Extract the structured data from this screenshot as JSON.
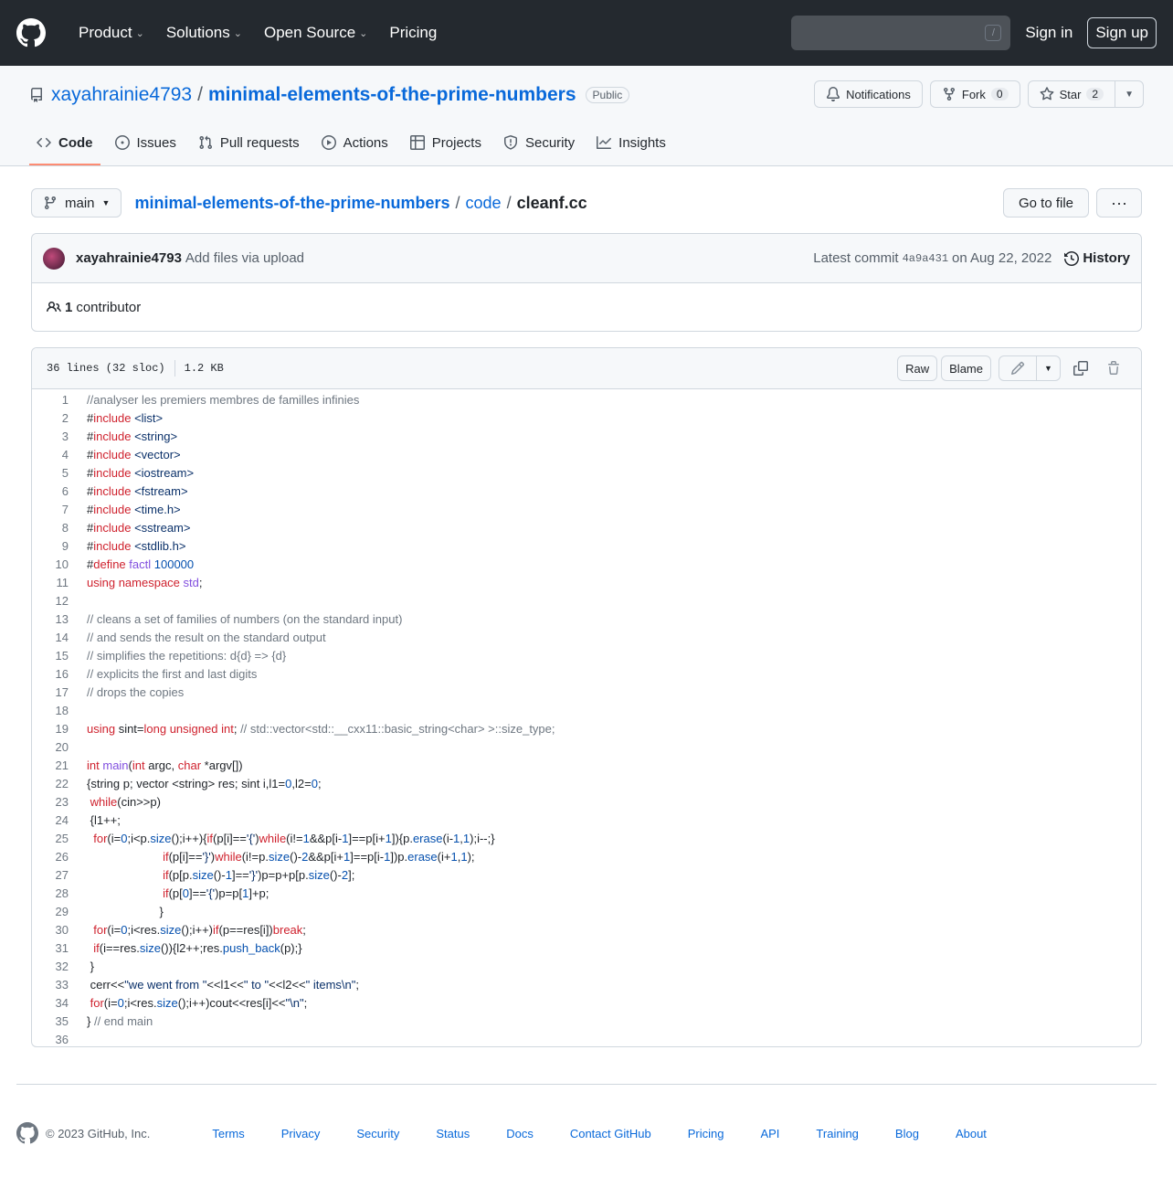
{
  "header": {
    "nav": [
      {
        "label": "Product",
        "chevron": true
      },
      {
        "label": "Solutions",
        "chevron": true
      },
      {
        "label": "Open Source",
        "chevron": true
      },
      {
        "label": "Pricing",
        "chevron": false
      }
    ],
    "search_shortcut": "/",
    "sign_in": "Sign in",
    "sign_up": "Sign up"
  },
  "repo": {
    "owner": "xayahrainie4793",
    "separator": "/",
    "name": "minimal-elements-of-the-prime-numbers",
    "visibility": "Public",
    "notifications_label": "Notifications",
    "fork_label": "Fork",
    "fork_count": "0",
    "star_label": "Star",
    "star_count": "2"
  },
  "tabs": [
    {
      "label": "Code",
      "icon": "code-icon",
      "active": true
    },
    {
      "label": "Issues",
      "icon": "issue-icon",
      "active": false
    },
    {
      "label": "Pull requests",
      "icon": "pull-request-icon",
      "active": false
    },
    {
      "label": "Actions",
      "icon": "play-icon",
      "active": false
    },
    {
      "label": "Projects",
      "icon": "table-icon",
      "active": false
    },
    {
      "label": "Security",
      "icon": "shield-icon",
      "active": false
    },
    {
      "label": "Insights",
      "icon": "graph-icon",
      "active": false
    }
  ],
  "breadcrumb": {
    "branch": "main",
    "repo": "minimal-elements-of-the-prime-numbers",
    "dir": "code",
    "file": "cleanf.cc",
    "go_to_file": "Go to file",
    "more": "···"
  },
  "commit": {
    "author": "xayahrainie4793",
    "message": "Add files via upload",
    "latest_prefix": "Latest commit",
    "sha": "4a9a431",
    "date": "on Aug 22, 2022",
    "history": "History",
    "contributors_count": "1",
    "contributors_label": "contributor"
  },
  "file": {
    "lines_info": "36 lines (32 sloc)",
    "size": "1.2 KB",
    "raw": "Raw",
    "blame": "Blame"
  },
  "code_lines": [
    [
      {
        "t": "//analyser les premiers membres de familles infinies",
        "c": "cm"
      }
    ],
    [
      {
        "t": "#",
        "c": "tx"
      },
      {
        "t": "include",
        "c": "kw"
      },
      {
        "t": " ",
        "c": "tx"
      },
      {
        "t": "<list>",
        "c": "st"
      }
    ],
    [
      {
        "t": "#",
        "c": "tx"
      },
      {
        "t": "include",
        "c": "kw"
      },
      {
        "t": " ",
        "c": "tx"
      },
      {
        "t": "<string>",
        "c": "st"
      }
    ],
    [
      {
        "t": "#",
        "c": "tx"
      },
      {
        "t": "include",
        "c": "kw"
      },
      {
        "t": " ",
        "c": "tx"
      },
      {
        "t": "<vector>",
        "c": "st"
      }
    ],
    [
      {
        "t": "#",
        "c": "tx"
      },
      {
        "t": "include",
        "c": "kw"
      },
      {
        "t": " ",
        "c": "tx"
      },
      {
        "t": "<iostream>",
        "c": "st"
      }
    ],
    [
      {
        "t": "#",
        "c": "tx"
      },
      {
        "t": "include",
        "c": "kw"
      },
      {
        "t": " ",
        "c": "tx"
      },
      {
        "t": "<fstream>",
        "c": "st"
      }
    ],
    [
      {
        "t": "#",
        "c": "tx"
      },
      {
        "t": "include",
        "c": "kw"
      },
      {
        "t": " ",
        "c": "tx"
      },
      {
        "t": "<time.h>",
        "c": "st"
      }
    ],
    [
      {
        "t": "#",
        "c": "tx"
      },
      {
        "t": "include",
        "c": "kw"
      },
      {
        "t": " ",
        "c": "tx"
      },
      {
        "t": "<sstream>",
        "c": "st"
      }
    ],
    [
      {
        "t": "#",
        "c": "tx"
      },
      {
        "t": "include",
        "c": "kw"
      },
      {
        "t": " ",
        "c": "tx"
      },
      {
        "t": "<stdlib.h>",
        "c": "st"
      }
    ],
    [
      {
        "t": "#",
        "c": "tx"
      },
      {
        "t": "define",
        "c": "kw"
      },
      {
        "t": " ",
        "c": "tx"
      },
      {
        "t": "factl",
        "c": "fn"
      },
      {
        "t": " ",
        "c": "tx"
      },
      {
        "t": "100000",
        "c": "nm"
      }
    ],
    [
      {
        "t": "using",
        "c": "kw"
      },
      {
        "t": " ",
        "c": "tx"
      },
      {
        "t": "namespace",
        "c": "kw"
      },
      {
        "t": " ",
        "c": "tx"
      },
      {
        "t": "std",
        "c": "fn"
      },
      {
        "t": ";",
        "c": "tx"
      }
    ],
    [],
    [
      {
        "t": "// cleans a set of families of numbers (on the standard input)",
        "c": "cm"
      }
    ],
    [
      {
        "t": "// and sends the result on the standard output",
        "c": "cm"
      }
    ],
    [
      {
        "t": "// simplifies the repetitions: d{d} => {d}",
        "c": "cm"
      }
    ],
    [
      {
        "t": "// explicits the first and last digits",
        "c": "cm"
      }
    ],
    [
      {
        "t": "// drops the copies",
        "c": "cm"
      }
    ],
    [],
    [
      {
        "t": "using",
        "c": "kw"
      },
      {
        "t": " sint=",
        "c": "tx"
      },
      {
        "t": "long unsigned int",
        "c": "kw"
      },
      {
        "t": "; ",
        "c": "tx"
      },
      {
        "t": "// std::vector<std::__cxx11::basic_string<char> >::size_type;",
        "c": "cm"
      }
    ],
    [],
    [
      {
        "t": "int",
        "c": "kw"
      },
      {
        "t": " ",
        "c": "tx"
      },
      {
        "t": "main",
        "c": "fn"
      },
      {
        "t": "(",
        "c": "tx"
      },
      {
        "t": "int",
        "c": "kw"
      },
      {
        "t": " argc, ",
        "c": "tx"
      },
      {
        "t": "char",
        "c": "kw"
      },
      {
        "t": " *argv[])",
        "c": "tx"
      }
    ],
    [
      {
        "t": "{string p; vector <string> res; sint i,l1=",
        "c": "tx"
      },
      {
        "t": "0",
        "c": "nm"
      },
      {
        "t": ",l2=",
        "c": "tx"
      },
      {
        "t": "0",
        "c": "nm"
      },
      {
        "t": ";",
        "c": "tx"
      }
    ],
    [
      {
        "t": " ",
        "c": "tx"
      },
      {
        "t": "while",
        "c": "kw"
      },
      {
        "t": "(cin>>p)",
        "c": "tx"
      }
    ],
    [
      {
        "t": " {l1++;",
        "c": "tx"
      }
    ],
    [
      {
        "t": "  ",
        "c": "tx"
      },
      {
        "t": "for",
        "c": "kw"
      },
      {
        "t": "(i=",
        "c": "tx"
      },
      {
        "t": "0",
        "c": "nm"
      },
      {
        "t": ";i<p.",
        "c": "tx"
      },
      {
        "t": "size",
        "c": "bl"
      },
      {
        "t": "();i++){",
        "c": "tx"
      },
      {
        "t": "if",
        "c": "kw"
      },
      {
        "t": "(p[i]==",
        "c": "tx"
      },
      {
        "t": "'{'",
        "c": "st"
      },
      {
        "t": ")",
        "c": "tx"
      },
      {
        "t": "while",
        "c": "kw"
      },
      {
        "t": "(i!=",
        "c": "tx"
      },
      {
        "t": "1",
        "c": "nm"
      },
      {
        "t": "&&p[i-",
        "c": "tx"
      },
      {
        "t": "1",
        "c": "nm"
      },
      {
        "t": "]==p[i+",
        "c": "tx"
      },
      {
        "t": "1",
        "c": "nm"
      },
      {
        "t": "]){p.",
        "c": "tx"
      },
      {
        "t": "erase",
        "c": "bl"
      },
      {
        "t": "(i-",
        "c": "tx"
      },
      {
        "t": "1",
        "c": "nm"
      },
      {
        "t": ",",
        "c": "tx"
      },
      {
        "t": "1",
        "c": "nm"
      },
      {
        "t": ");i--;}",
        "c": "tx"
      }
    ],
    [
      {
        "t": "                       ",
        "c": "tx"
      },
      {
        "t": "if",
        "c": "kw"
      },
      {
        "t": "(p[i]==",
        "c": "tx"
      },
      {
        "t": "'}'",
        "c": "st"
      },
      {
        "t": ")",
        "c": "tx"
      },
      {
        "t": "while",
        "c": "kw"
      },
      {
        "t": "(i!=p.",
        "c": "tx"
      },
      {
        "t": "size",
        "c": "bl"
      },
      {
        "t": "()-",
        "c": "tx"
      },
      {
        "t": "2",
        "c": "nm"
      },
      {
        "t": "&&p[i+",
        "c": "tx"
      },
      {
        "t": "1",
        "c": "nm"
      },
      {
        "t": "]==p[i-",
        "c": "tx"
      },
      {
        "t": "1",
        "c": "nm"
      },
      {
        "t": "])p.",
        "c": "tx"
      },
      {
        "t": "erase",
        "c": "bl"
      },
      {
        "t": "(i+",
        "c": "tx"
      },
      {
        "t": "1",
        "c": "nm"
      },
      {
        "t": ",",
        "c": "tx"
      },
      {
        "t": "1",
        "c": "nm"
      },
      {
        "t": ");",
        "c": "tx"
      }
    ],
    [
      {
        "t": "                       ",
        "c": "tx"
      },
      {
        "t": "if",
        "c": "kw"
      },
      {
        "t": "(p[p.",
        "c": "tx"
      },
      {
        "t": "size",
        "c": "bl"
      },
      {
        "t": "()-",
        "c": "tx"
      },
      {
        "t": "1",
        "c": "nm"
      },
      {
        "t": "]==",
        "c": "tx"
      },
      {
        "t": "'}'",
        "c": "st"
      },
      {
        "t": ")p=p+p[p.",
        "c": "tx"
      },
      {
        "t": "size",
        "c": "bl"
      },
      {
        "t": "()-",
        "c": "tx"
      },
      {
        "t": "2",
        "c": "nm"
      },
      {
        "t": "];",
        "c": "tx"
      }
    ],
    [
      {
        "t": "                       ",
        "c": "tx"
      },
      {
        "t": "if",
        "c": "kw"
      },
      {
        "t": "(p[",
        "c": "tx"
      },
      {
        "t": "0",
        "c": "nm"
      },
      {
        "t": "]==",
        "c": "tx"
      },
      {
        "t": "'{'",
        "c": "st"
      },
      {
        "t": ")p=p[",
        "c": "tx"
      },
      {
        "t": "1",
        "c": "nm"
      },
      {
        "t": "]+p;",
        "c": "tx"
      }
    ],
    [
      {
        "t": "                      }",
        "c": "tx"
      }
    ],
    [
      {
        "t": "  ",
        "c": "tx"
      },
      {
        "t": "for",
        "c": "kw"
      },
      {
        "t": "(i=",
        "c": "tx"
      },
      {
        "t": "0",
        "c": "nm"
      },
      {
        "t": ";i<res.",
        "c": "tx"
      },
      {
        "t": "size",
        "c": "bl"
      },
      {
        "t": "();i++)",
        "c": "tx"
      },
      {
        "t": "if",
        "c": "kw"
      },
      {
        "t": "(p==res[i])",
        "c": "tx"
      },
      {
        "t": "break",
        "c": "kw"
      },
      {
        "t": ";",
        "c": "tx"
      }
    ],
    [
      {
        "t": "  ",
        "c": "tx"
      },
      {
        "t": "if",
        "c": "kw"
      },
      {
        "t": "(i==res.",
        "c": "tx"
      },
      {
        "t": "size",
        "c": "bl"
      },
      {
        "t": "()){l2++;res.",
        "c": "tx"
      },
      {
        "t": "push_back",
        "c": "bl"
      },
      {
        "t": "(p);}",
        "c": "tx"
      }
    ],
    [
      {
        "t": " }",
        "c": "tx"
      }
    ],
    [
      {
        "t": " cerr<<",
        "c": "tx"
      },
      {
        "t": "\"we went from \"",
        "c": "st"
      },
      {
        "t": "<<l1<<",
        "c": "tx"
      },
      {
        "t": "\" to \"",
        "c": "st"
      },
      {
        "t": "<<l2<<",
        "c": "tx"
      },
      {
        "t": "\" items\\n\"",
        "c": "st"
      },
      {
        "t": ";",
        "c": "tx"
      }
    ],
    [
      {
        "t": " ",
        "c": "tx"
      },
      {
        "t": "for",
        "c": "kw"
      },
      {
        "t": "(i=",
        "c": "tx"
      },
      {
        "t": "0",
        "c": "nm"
      },
      {
        "t": ";i<res.",
        "c": "tx"
      },
      {
        "t": "size",
        "c": "bl"
      },
      {
        "t": "();i++)cout<<res[i]<<",
        "c": "tx"
      },
      {
        "t": "\"\\n\"",
        "c": "st"
      },
      {
        "t": ";",
        "c": "tx"
      }
    ],
    [
      {
        "t": "} ",
        "c": "tx"
      },
      {
        "t": "// end main",
        "c": "cm"
      }
    ],
    []
  ],
  "syntax_colors": {
    "cm": "#6e7781",
    "kw": "#cf222e",
    "st": "#0a3069",
    "fn": "#8250df",
    "nm": "#0550ae",
    "bl": "#0550ae",
    "tx": "#1f2328"
  },
  "footer": {
    "copyright": "© 2023 GitHub, Inc.",
    "links": [
      "Terms",
      "Privacy",
      "Security",
      "Status",
      "Docs",
      "Contact GitHub",
      "Pricing",
      "API",
      "Training",
      "Blog",
      "About"
    ]
  }
}
